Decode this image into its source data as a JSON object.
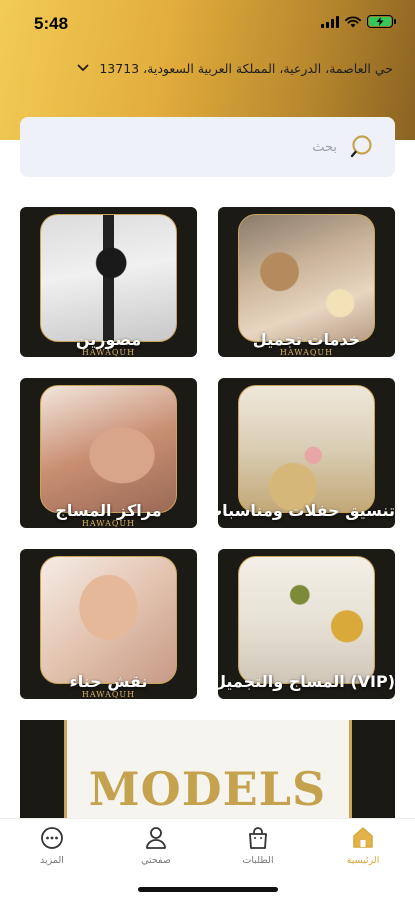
{
  "status": {
    "time": "5:48"
  },
  "header": {
    "location": "حي العاصمة، الدرعية، المملكة العربية السعودية، 13713"
  },
  "search": {
    "placeholder": "بحث"
  },
  "categories": [
    {
      "label": "خدمات تجميل",
      "brand": "HAWAQUH",
      "icon": "beauty-services"
    },
    {
      "label": "مصورين",
      "brand": "HAWAQUH",
      "icon": "photographers"
    },
    {
      "label": "تنسيق حفلات ومناسبات",
      "brand": "",
      "icon": "event-planning"
    },
    {
      "label": "مراكز المساج",
      "brand": "HAWAQUH",
      "icon": "massage-centers"
    },
    {
      "label": "(VIP) المساج والتجميل",
      "brand": "",
      "icon": "vip-massage-beauty"
    },
    {
      "label": "نقش حناء",
      "brand": "HAWAQUH",
      "icon": "henna"
    }
  ],
  "banner": {
    "text": "MODELS"
  },
  "tabbar": {
    "items": [
      {
        "label": "الرئيسية",
        "icon": "home-icon",
        "active": true
      },
      {
        "label": "الطلبات",
        "icon": "shopping-bag-icon",
        "active": false
      },
      {
        "label": "صفحتي",
        "icon": "user-icon",
        "active": false
      },
      {
        "label": "المزيد",
        "icon": "more-icon",
        "active": false
      }
    ]
  },
  "colors": {
    "accent": "#d8a83a",
    "gold": "#c5a24e",
    "header_start": "#f2cb55",
    "header_end": "#8b6322"
  }
}
